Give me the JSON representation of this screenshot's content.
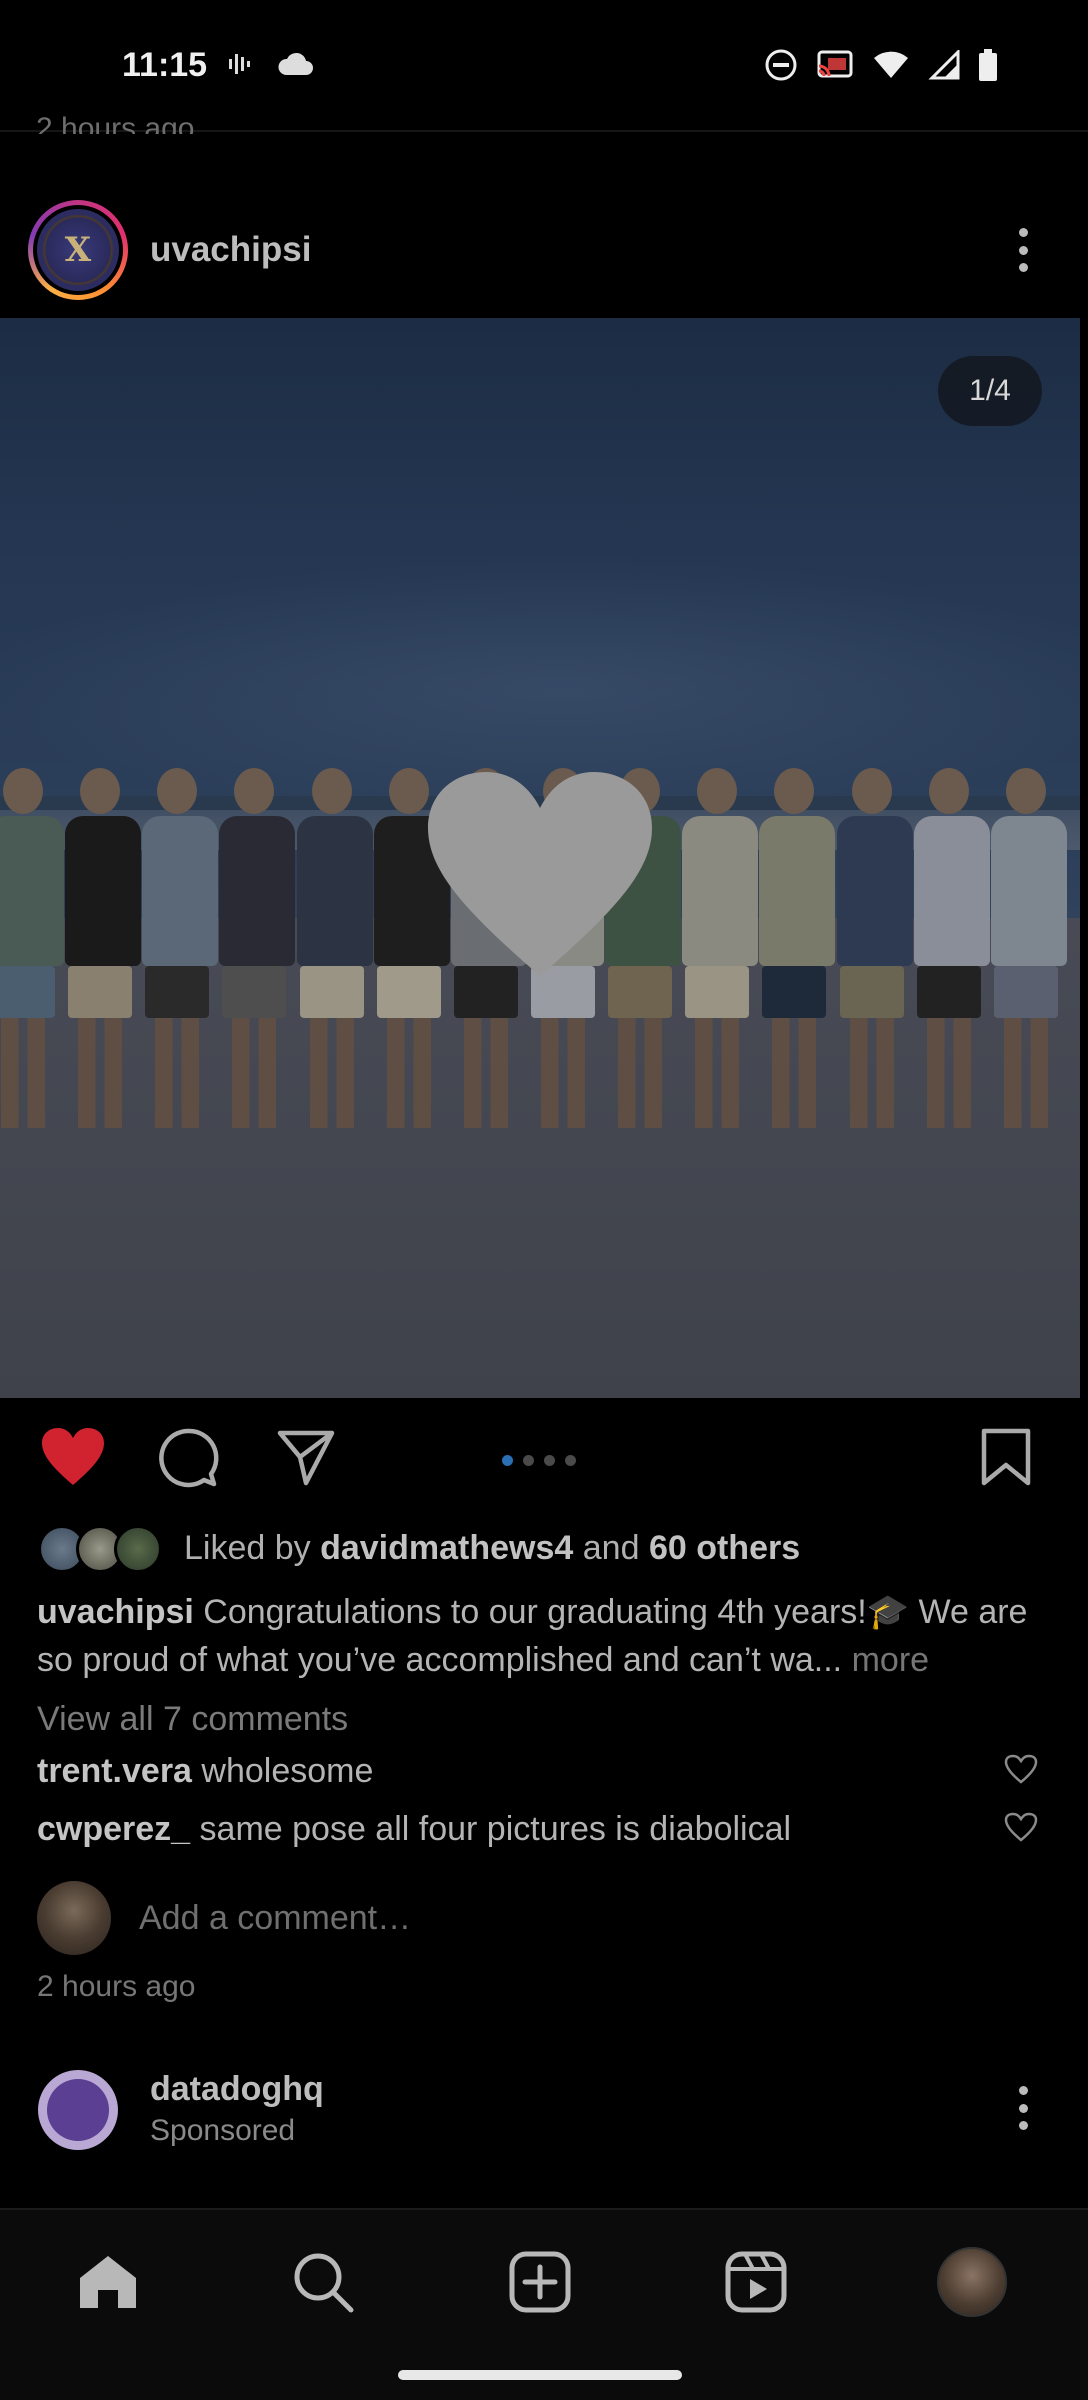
{
  "status_bar": {
    "time": "11:15",
    "left_icons": [
      "voicemail-icon",
      "cloud-icon"
    ],
    "right_icons": [
      "do-not-disturb-icon",
      "cast-icon",
      "wifi-icon",
      "signal-icon",
      "battery-icon"
    ]
  },
  "previous_post": {
    "timestamp": "2 hours ago"
  },
  "post": {
    "username": "uvachipsi",
    "avatar_letter": "X",
    "image_counter": "1/4",
    "carousel": {
      "total": 4,
      "active_index": 0
    },
    "liked": true,
    "likes": {
      "prefix": "Liked by",
      "user": "davidmathews4",
      "connector": "and",
      "others": "60 others"
    },
    "caption": {
      "username": "uvachipsi",
      "text": "Congratulations to our graduating 4th years!🎓 We are so proud of what you’ve accomplished and can’t wa...",
      "more": "more"
    },
    "view_comments": "View all 7 comments",
    "comments": [
      {
        "username": "trent.vera",
        "text": "wholesome"
      },
      {
        "username": "cwperez_",
        "text": "same pose all four pictures is diabolical"
      }
    ],
    "add_comment_placeholder": "Add a comment…",
    "timestamp": "2 hours ago"
  },
  "next_post": {
    "username": "datadoghq",
    "subtitle": "Sponsored"
  },
  "bottom_nav": [
    "home-icon",
    "search-icon",
    "create-icon",
    "reels-icon",
    "profile-avatar"
  ],
  "colors": {
    "like_red": "#d0222f",
    "carousel_active": "#2a6fb3",
    "background": "#000000"
  }
}
